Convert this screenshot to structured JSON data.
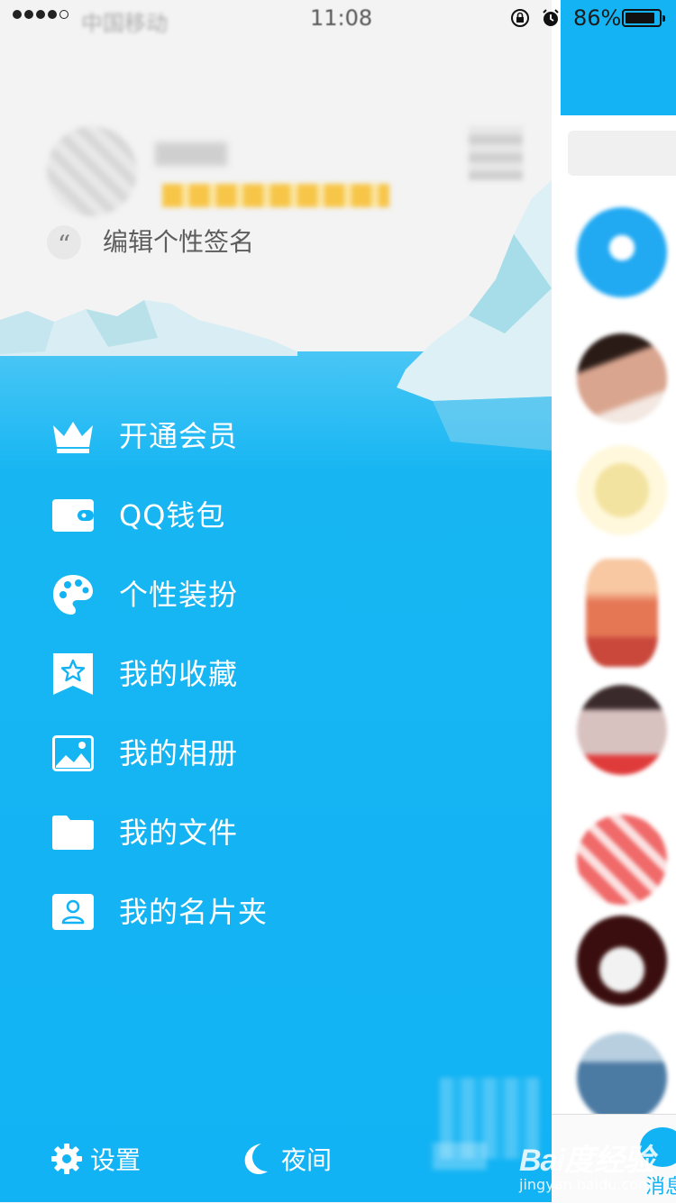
{
  "status_bar": {
    "carrier": "中国移动",
    "time": "11:08",
    "battery_percent": "86%",
    "icons": [
      "signal-dots-icon",
      "wifi-icon",
      "rotation-lock-icon",
      "alarm-icon",
      "battery-icon"
    ]
  },
  "profile": {
    "signature_prompt": "编辑个性签名",
    "quote_mark": "“"
  },
  "menu": {
    "items": [
      {
        "label": "开通会员",
        "icon": "crown-icon"
      },
      {
        "label": "QQ钱包",
        "icon": "wallet-icon"
      },
      {
        "label": "个性装扮",
        "icon": "palette-icon"
      },
      {
        "label": "我的收藏",
        "icon": "bookmark-star-icon"
      },
      {
        "label": "我的相册",
        "icon": "photo-icon"
      },
      {
        "label": "我的文件",
        "icon": "folder-icon"
      },
      {
        "label": "我的名片夹",
        "icon": "contact-card-icon"
      }
    ]
  },
  "bottom_bar": {
    "settings_label": "设置",
    "night_label": "夜间"
  },
  "right_panel": {
    "tab_label": "消息"
  },
  "watermark": {
    "brand": "Bai度经验",
    "url": "jingyan.baidu.com"
  },
  "colors": {
    "accent_blue": "#12b3f4",
    "header_bg": "#f3f3f3",
    "text_gray": "#5d5d5d"
  }
}
